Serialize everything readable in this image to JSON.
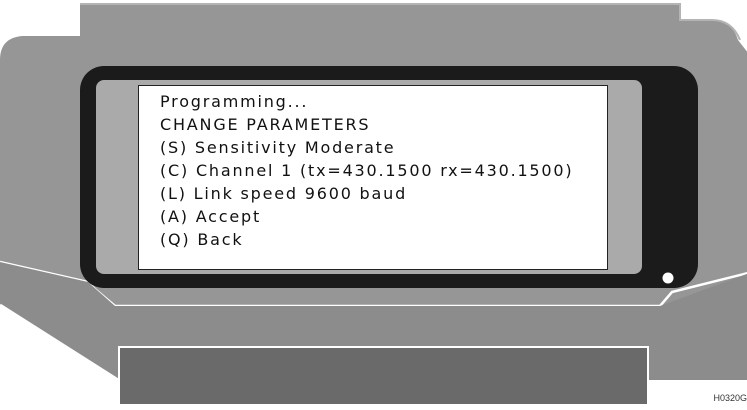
{
  "screen": {
    "lines": [
      "Programming...",
      "CHANGE PARAMETERS",
      "(S) Sensitivity Moderate",
      "(C) Channel 1 (tx=430.1500 rx=430.1500)",
      "(L) Link speed 9600 baud",
      "(A) Accept",
      "(Q) Back"
    ]
  },
  "figure_code": "H0320G",
  "colors": {
    "body": "#969696",
    "bezel": "#1b1b1b",
    "bezel_inset": "#aaaaaa",
    "screen": "#ffffff",
    "outline": "#ffffff"
  },
  "icons": {
    "indicator": "status-led-icon"
  }
}
